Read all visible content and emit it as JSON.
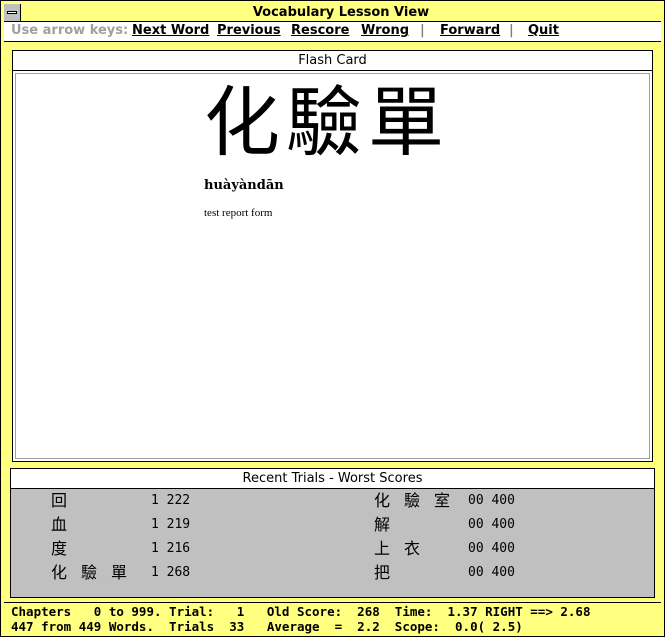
{
  "window": {
    "title": "Vocabulary Lesson View"
  },
  "menu": {
    "hint": "Use arrow keys:",
    "items": [
      {
        "label": "Next Word"
      },
      {
        "label": "Previous"
      },
      {
        "label": "Rescore"
      },
      {
        "label": "Wrong"
      },
      {
        "label": "Forward"
      },
      {
        "label": "Quit"
      }
    ],
    "separator": "|"
  },
  "flash_card": {
    "header": "Flash Card",
    "hanzi": "化驗單",
    "pinyin": "huàyàndān",
    "gloss": "test report form"
  },
  "recent_trials": {
    "header": "Recent Trials - Worst Scores",
    "left": [
      {
        "word": "回",
        "score": "1 222"
      },
      {
        "word": "血",
        "score": "1 219"
      },
      {
        "word": "度",
        "score": "1 216"
      },
      {
        "word": "化驗單",
        "score": "1 268"
      }
    ],
    "right": [
      {
        "word": "化驗室",
        "score": "00 400"
      },
      {
        "word": "解",
        "score": "00 400"
      },
      {
        "word": "上衣",
        "score": "00 400"
      },
      {
        "word": "把",
        "score": "00 400"
      }
    ]
  },
  "status": {
    "line1": "Chapters   0 to 999. Trial:   1   Old Score:  268  Time:  1.37 RIGHT ==> 2.68",
    "line2": "447 from 449 Words.  Trials  33   Average  =  2.2  Scope:  0.0( 2.5)"
  },
  "colors": {
    "frame": "#ffff80",
    "trials_bg": "#c0c0c0",
    "hint_text": "#a0a0a0"
  }
}
